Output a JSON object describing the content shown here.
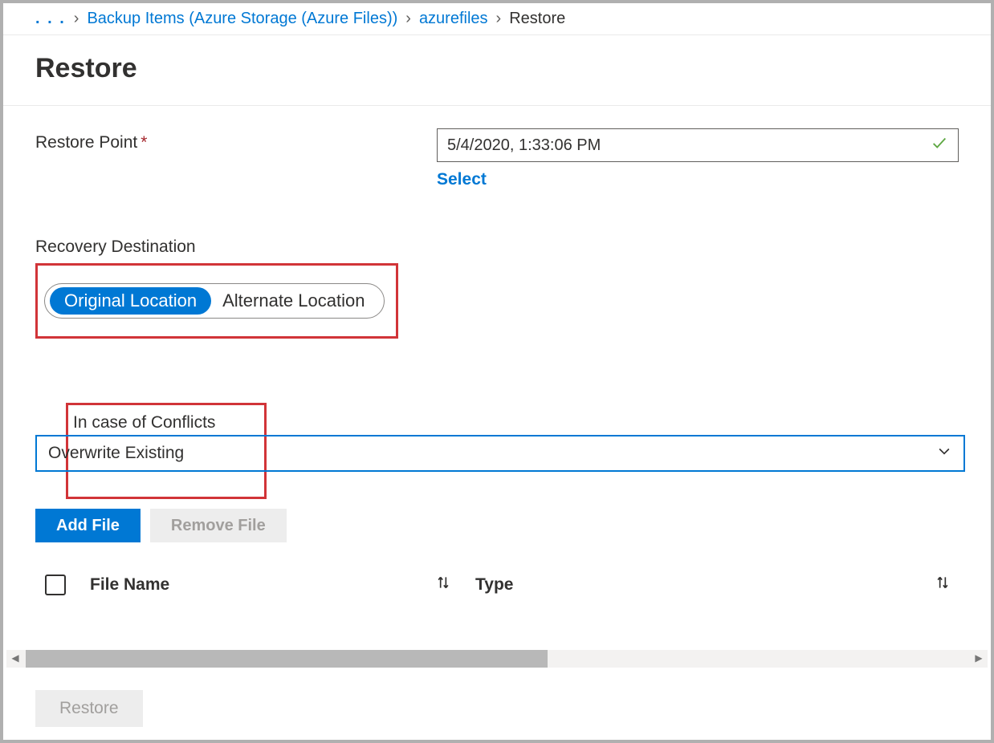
{
  "breadcrumbs": {
    "ellipsis": ". . .",
    "item1": "Backup Items (Azure Storage (Azure Files))",
    "item2": "azurefiles",
    "current": "Restore"
  },
  "title": "Restore",
  "restorePoint": {
    "label": "Restore Point",
    "value": "5/4/2020, 1:33:06 PM",
    "selectLink": "Select"
  },
  "recovery": {
    "label": "Recovery Destination",
    "option1": "Original Location",
    "option2": "Alternate Location"
  },
  "conflicts": {
    "label": "In case of Conflicts",
    "value": "Overwrite Existing"
  },
  "buttons": {
    "add": "Add File",
    "remove": "Remove File",
    "restore": "Restore"
  },
  "table": {
    "col1": "File Name",
    "col2": "Type"
  }
}
